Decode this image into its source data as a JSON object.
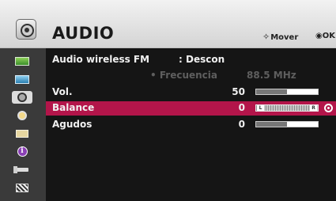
{
  "header": {
    "title": "AUDIO",
    "hint_move": "Mover",
    "hint_ok": "OK",
    "icon": "audio-speaker-icon"
  },
  "sidebar": {
    "items": [
      {
        "name": "picture-icon",
        "active": false
      },
      {
        "name": "image-icon",
        "active": false
      },
      {
        "name": "audio-icon",
        "active": true
      },
      {
        "name": "time-icon",
        "active": false
      },
      {
        "name": "option-icon",
        "active": false
      },
      {
        "name": "info-icon",
        "active": false
      },
      {
        "name": "input-icon",
        "active": false
      },
      {
        "name": "clapper-icon",
        "active": false
      }
    ]
  },
  "menu": {
    "fm": {
      "label": "Audio wireless FM",
      "value": ": Descon"
    },
    "frequency": {
      "label": "• Frecuencia",
      "value": "88.5 MHz"
    },
    "volume": {
      "label": "Vol.",
      "value": "50",
      "level": 0.5
    },
    "balance": {
      "label": "Balance",
      "value": "0",
      "left_letter": "L",
      "right_letter": "R"
    },
    "agudos": {
      "label": "Agudos",
      "value": "0",
      "level": 0.5
    }
  },
  "colors": {
    "selected_row": "#b3154a",
    "panel": "#151515",
    "sidebar": "#3a3a3a"
  }
}
